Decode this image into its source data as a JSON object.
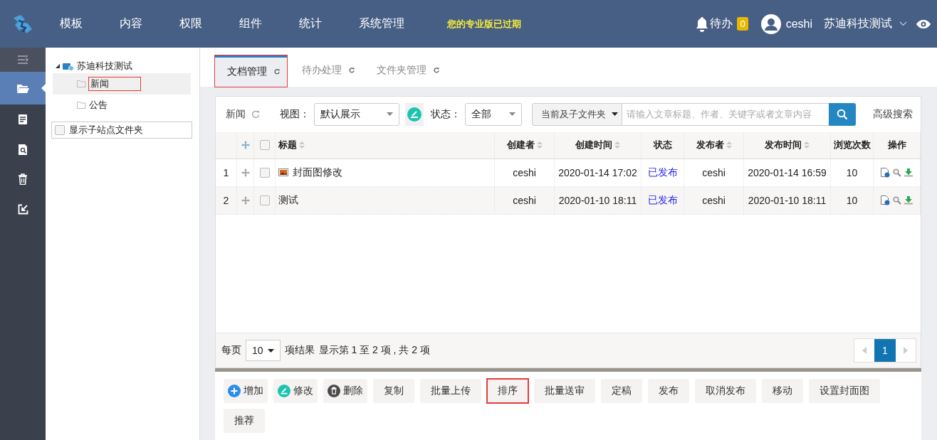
{
  "header": {
    "nav": [
      "模板",
      "内容",
      "权限",
      "组件",
      "统计",
      "系统管理"
    ],
    "notice": "您的专业版已过期",
    "todo": {
      "label": "待办",
      "count": "0"
    },
    "user": "ceshi",
    "org": "苏迪科技测试"
  },
  "sidebar": {
    "items": [
      {
        "kind": "collapse",
        "selected": false
      },
      {
        "kind": "folder",
        "selected": true
      },
      {
        "kind": "document",
        "selected": false
      },
      {
        "kind": "search-document",
        "selected": false
      },
      {
        "kind": "trash",
        "selected": false
      },
      {
        "kind": "export",
        "selected": false
      }
    ]
  },
  "tree": {
    "label": "苏迪科技测试",
    "expanded": true,
    "children": [
      {
        "label": "新闻",
        "selected": true,
        "highlighted": true
      },
      {
        "label": "公告",
        "selected": false,
        "highlighted": false
      }
    ]
  },
  "show_subsite": {
    "label": "显示子站点文件夹",
    "checked": false
  },
  "tabs": [
    {
      "label": "文档管理",
      "selected": true,
      "highlighted": true
    },
    {
      "label": "待办处理",
      "selected": false,
      "highlighted": false
    },
    {
      "label": "文件夹管理",
      "selected": false,
      "highlighted": false
    }
  ],
  "toolbar": {
    "folder": "新闻",
    "view_label": "视图：",
    "view_value": "默认展示",
    "status_label": "状态：",
    "status_value": "全部",
    "scope": "当前及子文件夹",
    "search_placeholder": "请输入文章标题、作者、关键字或者文章内容",
    "advanced": "高级搜索"
  },
  "table": {
    "all_checked": false,
    "columns": [
      {
        "label": "标题",
        "sortable": true
      },
      {
        "label": "创建者",
        "sortable": true
      },
      {
        "label": "创建时间",
        "sortable": true
      },
      {
        "label": "状态",
        "sortable": false
      },
      {
        "label": "发布者",
        "sortable": true
      },
      {
        "label": "发布时间",
        "sortable": true
      },
      {
        "label": "浏览次数",
        "sortable": false
      },
      {
        "label": "操作",
        "sortable": false
      }
    ],
    "rows": [
      {
        "num": "1",
        "title": "封面图修改",
        "has_cover": true,
        "checked": false,
        "creator": "ceshi",
        "created": "2020-01-14 17:02",
        "status": "已发布",
        "publisher": "ceshi",
        "published": "2020-01-14 16:59",
        "views": "10"
      },
      {
        "num": "2",
        "title": "测试",
        "has_cover": false,
        "checked": false,
        "creator": "ceshi",
        "created": "2020-01-10 18:11",
        "status": "已发布",
        "publisher": "ceshi",
        "published": "2020-01-10 18:11",
        "views": "10"
      }
    ]
  },
  "pagination": {
    "per_page_label": "每页",
    "per_page": "10",
    "results_label": "项结果",
    "info": "显示第 1 至 2 项 , 共 2 项",
    "pages": [
      {
        "label": "1",
        "selected": true
      }
    ]
  },
  "actions": [
    {
      "label": "增加",
      "kind": "add",
      "highlighted": false
    },
    {
      "label": "修改",
      "kind": "edit",
      "highlighted": false
    },
    {
      "label": "删除",
      "kind": "delete",
      "highlighted": false
    },
    {
      "label": "复制",
      "kind": "text",
      "highlighted": false
    },
    {
      "label": "批量上传",
      "kind": "text",
      "highlighted": false
    },
    {
      "label": "排序",
      "kind": "text",
      "highlighted": true
    },
    {
      "label": "批量送审",
      "kind": "text",
      "highlighted": false
    },
    {
      "label": "定稿",
      "kind": "text",
      "highlighted": false
    },
    {
      "label": "发布",
      "kind": "text",
      "highlighted": false
    },
    {
      "label": "取消发布",
      "kind": "text",
      "highlighted": false
    },
    {
      "label": "移动",
      "kind": "text",
      "highlighted": false
    },
    {
      "label": "设置封面图",
      "kind": "text",
      "highlighted": false
    },
    {
      "label": "推荐",
      "kind": "text",
      "highlighted": false
    }
  ]
}
